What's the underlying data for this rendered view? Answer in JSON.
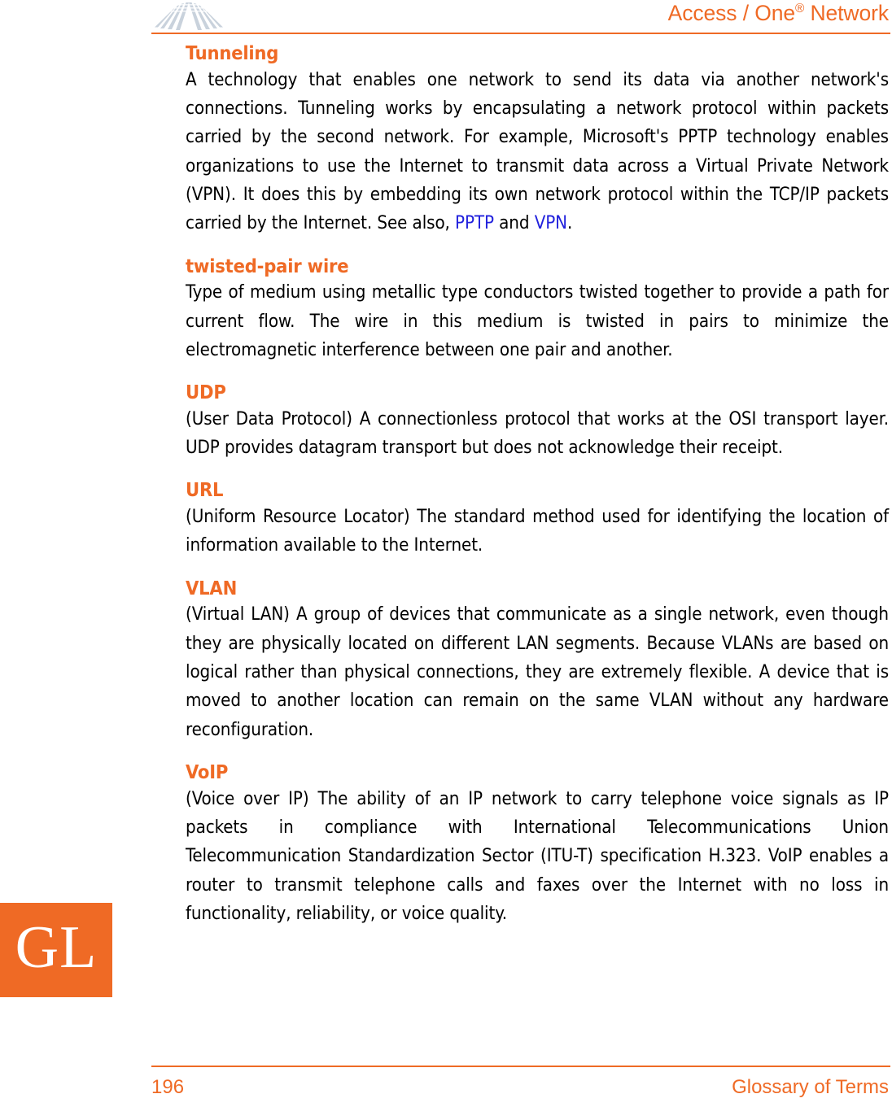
{
  "colors": {
    "accent_orange": "#ef6a25",
    "xref_blue": "#2222dd",
    "logo_gray": "#c9d2dc",
    "body_text": "#000000",
    "page_background": "#ffffff"
  },
  "header": {
    "logo_name": "access-one-fan-logo",
    "title_prefix": "Access / One",
    "title_superscript": "®",
    "title_suffix": " Network"
  },
  "side_tab": {
    "label": "GL"
  },
  "footer": {
    "page_number": "196",
    "section_title": "Glossary of Terms"
  },
  "glossary": {
    "entries": [
      {
        "term": "Tunneling",
        "definition_parts": [
          {
            "type": "text",
            "value": "A technology that enables one network to send its data via another network's connections. Tunneling works by encapsulating a network protocol within packets carried by the second network. For example, Microsoft's PPTP technology enables organizations to use the Internet to transmit data across a Virtual Private Network (VPN). It does this by embedding its own network protocol within the TCP/IP packets carried by the Internet. See also, "
          },
          {
            "type": "xref",
            "value": "PPTP"
          },
          {
            "type": "text",
            "value": " and "
          },
          {
            "type": "xref",
            "value": "VPN"
          },
          {
            "type": "text",
            "value": "."
          }
        ]
      },
      {
        "term": "twisted-pair wire",
        "definition_parts": [
          {
            "type": "text",
            "value": "Type of medium using metallic type conductors twisted together to provide a path for current flow. The wire in this medium is twisted in pairs to minimize the electromagnetic interference between one pair and another."
          }
        ]
      },
      {
        "term": "UDP",
        "definition_parts": [
          {
            "type": "text",
            "value": "(User Data Protocol) A connectionless protocol that works at the OSI transport layer. UDP provides datagram transport but does not acknowledge their receipt."
          }
        ]
      },
      {
        "term": "URL",
        "definition_parts": [
          {
            "type": "text",
            "value": "(Uniform Resource Locator) The standard method used for identifying the location of information available to the Internet."
          }
        ]
      },
      {
        "term": "VLAN",
        "definition_parts": [
          {
            "type": "text",
            "value": "(Virtual LAN) A group of devices that communicate as a single network, even though they are physically located on different LAN segments. Because VLANs are based on logical rather than physical connections, they are extremely flexible. A device that is moved to another location can remain on the same VLAN without any hardware reconfiguration."
          }
        ]
      },
      {
        "term": "VoIP",
        "definition_parts": [
          {
            "type": "text",
            "value": "(Voice over IP) The ability of an IP network to carry telephone voice signals as IP packets in compliance with International Telecommunications Union Telecommunication Standardization Sector (ITU-T) specification H.323. VoIP enables a router to transmit telephone calls and faxes over the Internet with no loss in functionality, reliability, or voice quality."
          }
        ]
      }
    ]
  }
}
